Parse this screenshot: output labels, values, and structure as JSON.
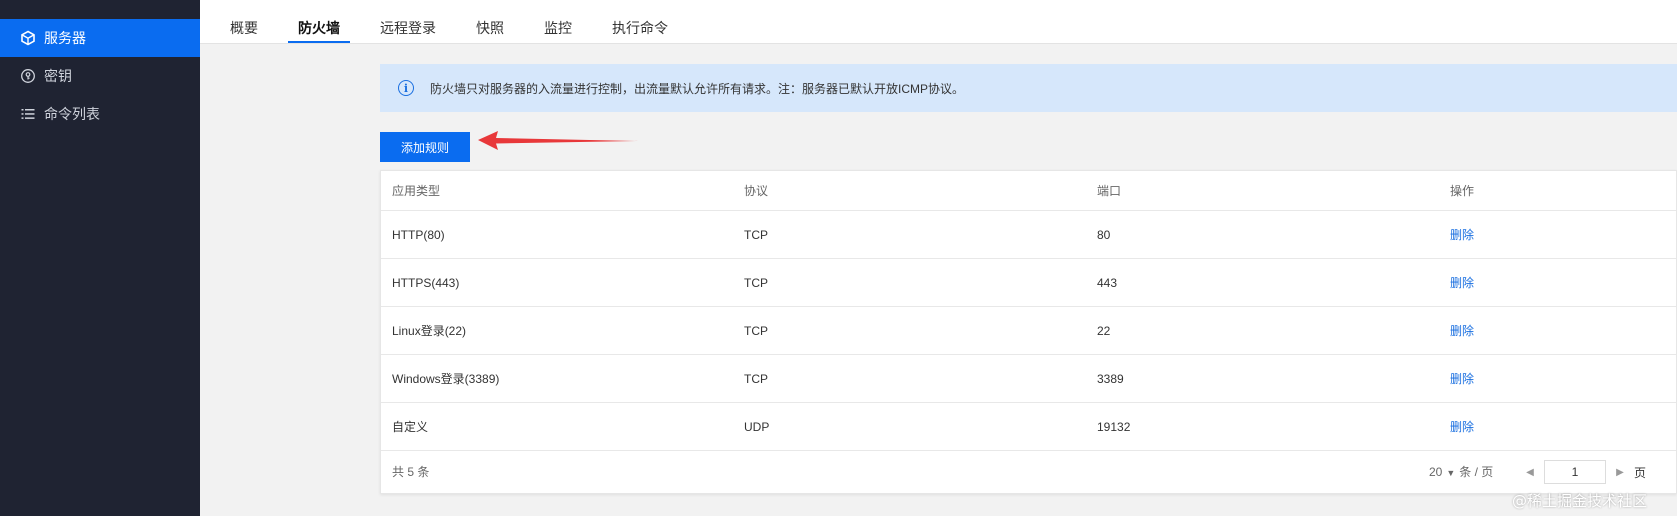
{
  "sidebar": {
    "items": [
      {
        "label": "服务器",
        "icon": "cube-icon",
        "active": true
      },
      {
        "label": "密钥",
        "icon": "key-icon",
        "active": false
      },
      {
        "label": "命令列表",
        "icon": "list-icon",
        "active": false
      }
    ]
  },
  "tabs": [
    {
      "label": "概要"
    },
    {
      "label": "防火墙",
      "active": true
    },
    {
      "label": "远程登录"
    },
    {
      "label": "快照"
    },
    {
      "label": "监控"
    },
    {
      "label": "执行命令"
    }
  ],
  "banner": {
    "text": "防火墙只对服务器的入流量进行控制，出流量默认允许所有请求。注：服务器已默认开放ICMP协议。"
  },
  "add_rule_label": "添加规则",
  "table": {
    "headers": [
      "应用类型",
      "协议",
      "端口",
      "操作"
    ],
    "rows": [
      {
        "type": "HTTP(80)",
        "protocol": "TCP",
        "port": "80",
        "action": "删除"
      },
      {
        "type": "HTTPS(443)",
        "protocol": "TCP",
        "port": "443",
        "action": "删除"
      },
      {
        "type": "Linux登录(22)",
        "protocol": "TCP",
        "port": "22",
        "action": "删除"
      },
      {
        "type": "Windows登录(3389)",
        "protocol": "TCP",
        "port": "3389",
        "action": "删除"
      },
      {
        "type": "自定义",
        "protocol": "UDP",
        "port": "19132",
        "action": "删除"
      }
    ],
    "footer": {
      "total": "共 5 条",
      "page_size": "20",
      "page_size_unit": "条 / 页",
      "current_page": "1",
      "page_suffix": "页"
    }
  },
  "watermark": "@稀土掘金技术社区",
  "colors": {
    "accent": "#0a6cf0",
    "sidebar": "#1f2332",
    "banner": "#d6e7fb",
    "arrow": "#e8383a"
  }
}
